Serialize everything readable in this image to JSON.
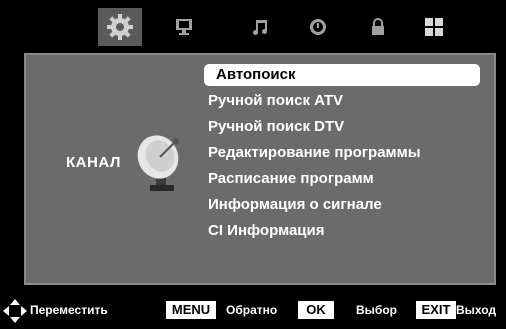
{
  "tabs": [
    {
      "icon": "gear-icon",
      "active": true
    },
    {
      "icon": "monitor-icon",
      "active": false
    },
    {
      "icon": "music-note-icon",
      "active": false
    },
    {
      "icon": "clock-icon",
      "active": false
    },
    {
      "icon": "lock-icon",
      "active": false
    },
    {
      "icon": "grid-icon",
      "active": false
    }
  ],
  "section": {
    "label": "КАНАЛ",
    "icon": "satellite-dish-icon"
  },
  "menu": {
    "items": [
      "Автопоиск",
      "Ручной поиск ATV",
      "Ручной поиск DTV",
      "Редактирование программы",
      "Расписание программ",
      "Информация о сигнале",
      "CI Информация"
    ],
    "selected_index": 0
  },
  "hints": {
    "move_label": "Переместить",
    "menu_key": "MENU",
    "back_label": "Обратно",
    "ok_key": "OK",
    "select_label": "Выбор",
    "exit_key": "EXIT",
    "exit_label": "Выход"
  },
  "colors": {
    "panel": "#6b6b6b",
    "background": "#000000",
    "selected": "#ffffff"
  }
}
